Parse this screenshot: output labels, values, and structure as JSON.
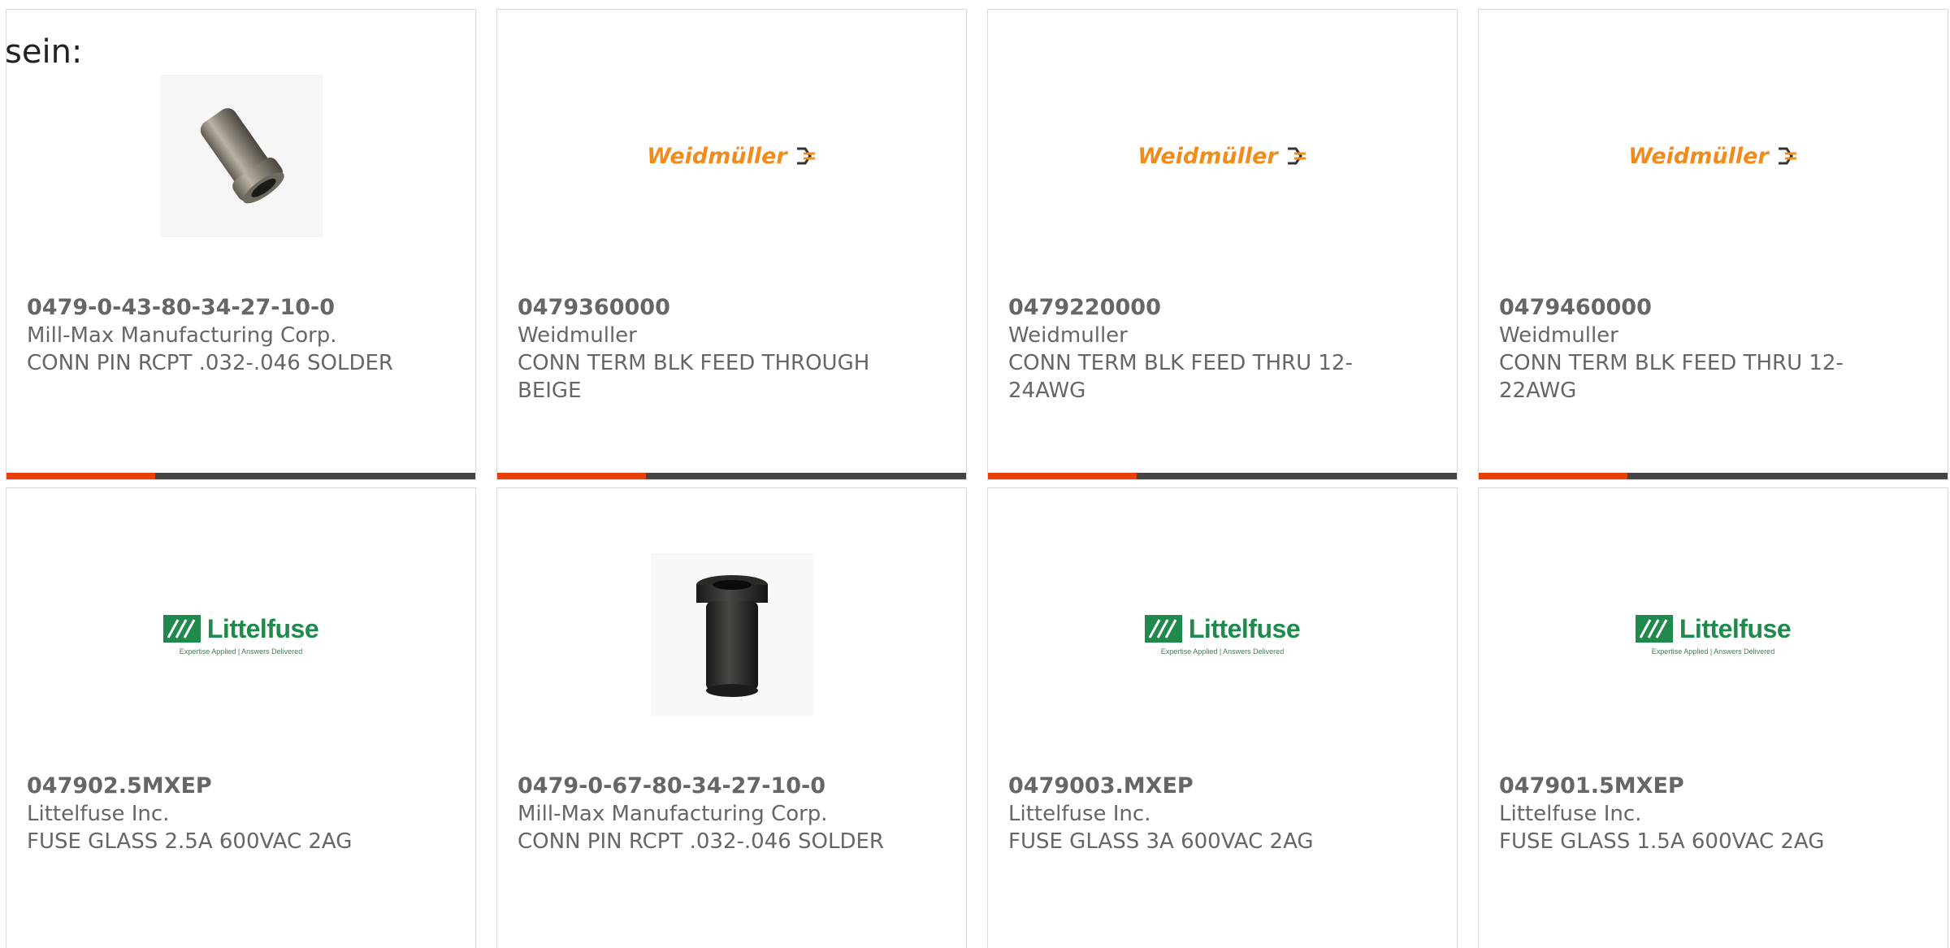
{
  "prefix_text": "sein:",
  "colors": {
    "accent_bar": "#e8400b",
    "dark_bar": "#444444",
    "weidmuller_orange": "#f08c1c",
    "littelfuse_green": "#1f8a4c",
    "text_gray": "#666666"
  },
  "logos": {
    "weidmuller": "Weidmüller",
    "littelfuse": "Littelfuse",
    "littelfuse_tagline": "Expertise Applied | Answers Delivered"
  },
  "products": [
    {
      "part_number": "0479-0-43-80-34-27-10-0",
      "manufacturer": "Mill-Max Manufacturing Corp.",
      "description": "CONN PIN RCPT .032-.046 SOLDER",
      "image": "silver-pin-receptacle-photo"
    },
    {
      "part_number": "0479360000",
      "manufacturer": "Weidmuller",
      "description": "CONN TERM BLK FEED THROUGH BEIGE",
      "image": "weidmuller-logo"
    },
    {
      "part_number": "0479220000",
      "manufacturer": "Weidmuller",
      "description": "CONN TERM BLK FEED THRU 12-24AWG",
      "image": "weidmuller-logo"
    },
    {
      "part_number": "0479460000",
      "manufacturer": "Weidmuller",
      "description": "CONN TERM BLK FEED THRU 12-22AWG",
      "image": "weidmuller-logo"
    },
    {
      "part_number": "047902.5MXEP",
      "manufacturer": "Littelfuse Inc.",
      "description": "FUSE GLASS 2.5A 600VAC 2AG",
      "image": "littelfuse-logo"
    },
    {
      "part_number": "0479-0-67-80-34-27-10-0",
      "manufacturer": "Mill-Max Manufacturing Corp.",
      "description": "CONN PIN RCPT .032-.046 SOLDER",
      "image": "black-pin-receptacle-photo"
    },
    {
      "part_number": "0479003.MXEP",
      "manufacturer": "Littelfuse Inc.",
      "description": "FUSE GLASS 3A 600VAC 2AG",
      "image": "littelfuse-logo"
    },
    {
      "part_number": "047901.5MXEP",
      "manufacturer": "Littelfuse Inc.",
      "description": "FUSE GLASS 1.5A 600VAC 2AG",
      "image": "littelfuse-logo"
    }
  ]
}
